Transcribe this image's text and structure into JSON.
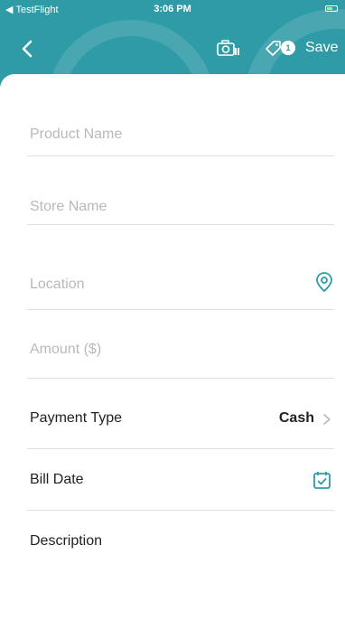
{
  "status_bar": {
    "carrier": "TestFlight",
    "time": "3:06 PM"
  },
  "toolbar": {
    "tag_count": "1",
    "save_label": "Save"
  },
  "form": {
    "product_name_placeholder": "Product Name",
    "store_name_placeholder": "Store Name",
    "location_placeholder": "Location",
    "amount_placeholder": "Amount ($)",
    "payment_type_label": "Payment Type",
    "payment_type_value": "Cash",
    "bill_date_label": "Bill Date",
    "description_label": "Description"
  },
  "colors": {
    "header": "#2f9ba6",
    "accent": "#2f9ba6",
    "placeholder": "#b9b9b9",
    "divider": "#e0e0e0"
  },
  "icons": {
    "back": "chevron-left-icon",
    "camera": "camera-icon",
    "tag": "tag-icon",
    "location": "location-pin-icon",
    "calendar": "calendar-icon",
    "chevron": "chevron-right-icon"
  }
}
